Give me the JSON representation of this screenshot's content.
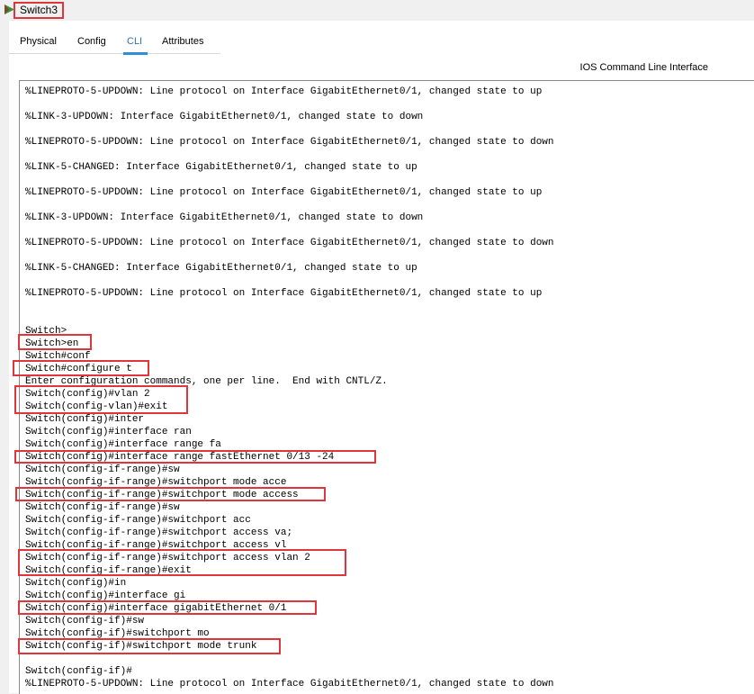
{
  "window": {
    "title": "Switch3"
  },
  "tabs": [
    {
      "label": "Physical"
    },
    {
      "label": "Config"
    },
    {
      "label": "CLI",
      "active": true
    },
    {
      "label": "Attributes"
    }
  ],
  "cli": {
    "header": "IOS Command Line Interface",
    "lines": [
      "%LINEPROTO-5-UPDOWN: Line protocol on Interface GigabitEthernet0/1, changed state to up",
      "",
      "%LINK-3-UPDOWN: Interface GigabitEthernet0/1, changed state to down",
      "",
      "%LINEPROTO-5-UPDOWN: Line protocol on Interface GigabitEthernet0/1, changed state to down",
      "",
      "%LINK-5-CHANGED: Interface GigabitEthernet0/1, changed state to up",
      "",
      "%LINEPROTO-5-UPDOWN: Line protocol on Interface GigabitEthernet0/1, changed state to up",
      "",
      "%LINK-3-UPDOWN: Interface GigabitEthernet0/1, changed state to down",
      "",
      "%LINEPROTO-5-UPDOWN: Line protocol on Interface GigabitEthernet0/1, changed state to down",
      "",
      "%LINK-5-CHANGED: Interface GigabitEthernet0/1, changed state to up",
      "",
      "%LINEPROTO-5-UPDOWN: Line protocol on Interface GigabitEthernet0/1, changed state to up",
      "",
      "",
      "Switch>",
      "Switch>en",
      "Switch#conf",
      "Switch#configure t",
      "Enter configuration commands, one per line.  End with CNTL/Z.",
      "Switch(config)#vlan 2",
      "Switch(config-vlan)#exit",
      "Switch(config)#inter",
      "Switch(config)#interface ran",
      "Switch(config)#interface range fa",
      "Switch(config)#interface range fastEthernet 0/13 -24",
      "Switch(config-if-range)#sw",
      "Switch(config-if-range)#switchport mode acce",
      "Switch(config-if-range)#switchport mode access",
      "Switch(config-if-range)#sw",
      "Switch(config-if-range)#switchport acc",
      "Switch(config-if-range)#switchport access va;",
      "Switch(config-if-range)#switchport access vl",
      "Switch(config-if-range)#switchport access vlan 2",
      "Switch(config-if-range)#exit",
      "Switch(config)#in",
      "Switch(config)#interface gi",
      "Switch(config)#interface gigabitEthernet 0/1",
      "Switch(config-if)#sw",
      "Switch(config-if)#switchport mo",
      "Switch(config-if)#switchport mode trunk",
      "",
      "Switch(config-if)#",
      "%LINEPROTO-5-UPDOWN: Line protocol on Interface GigabitEthernet0/1, changed state to down"
    ]
  },
  "colors": {
    "highlight": "#e0363b",
    "active_tab": "#2e75b6"
  }
}
